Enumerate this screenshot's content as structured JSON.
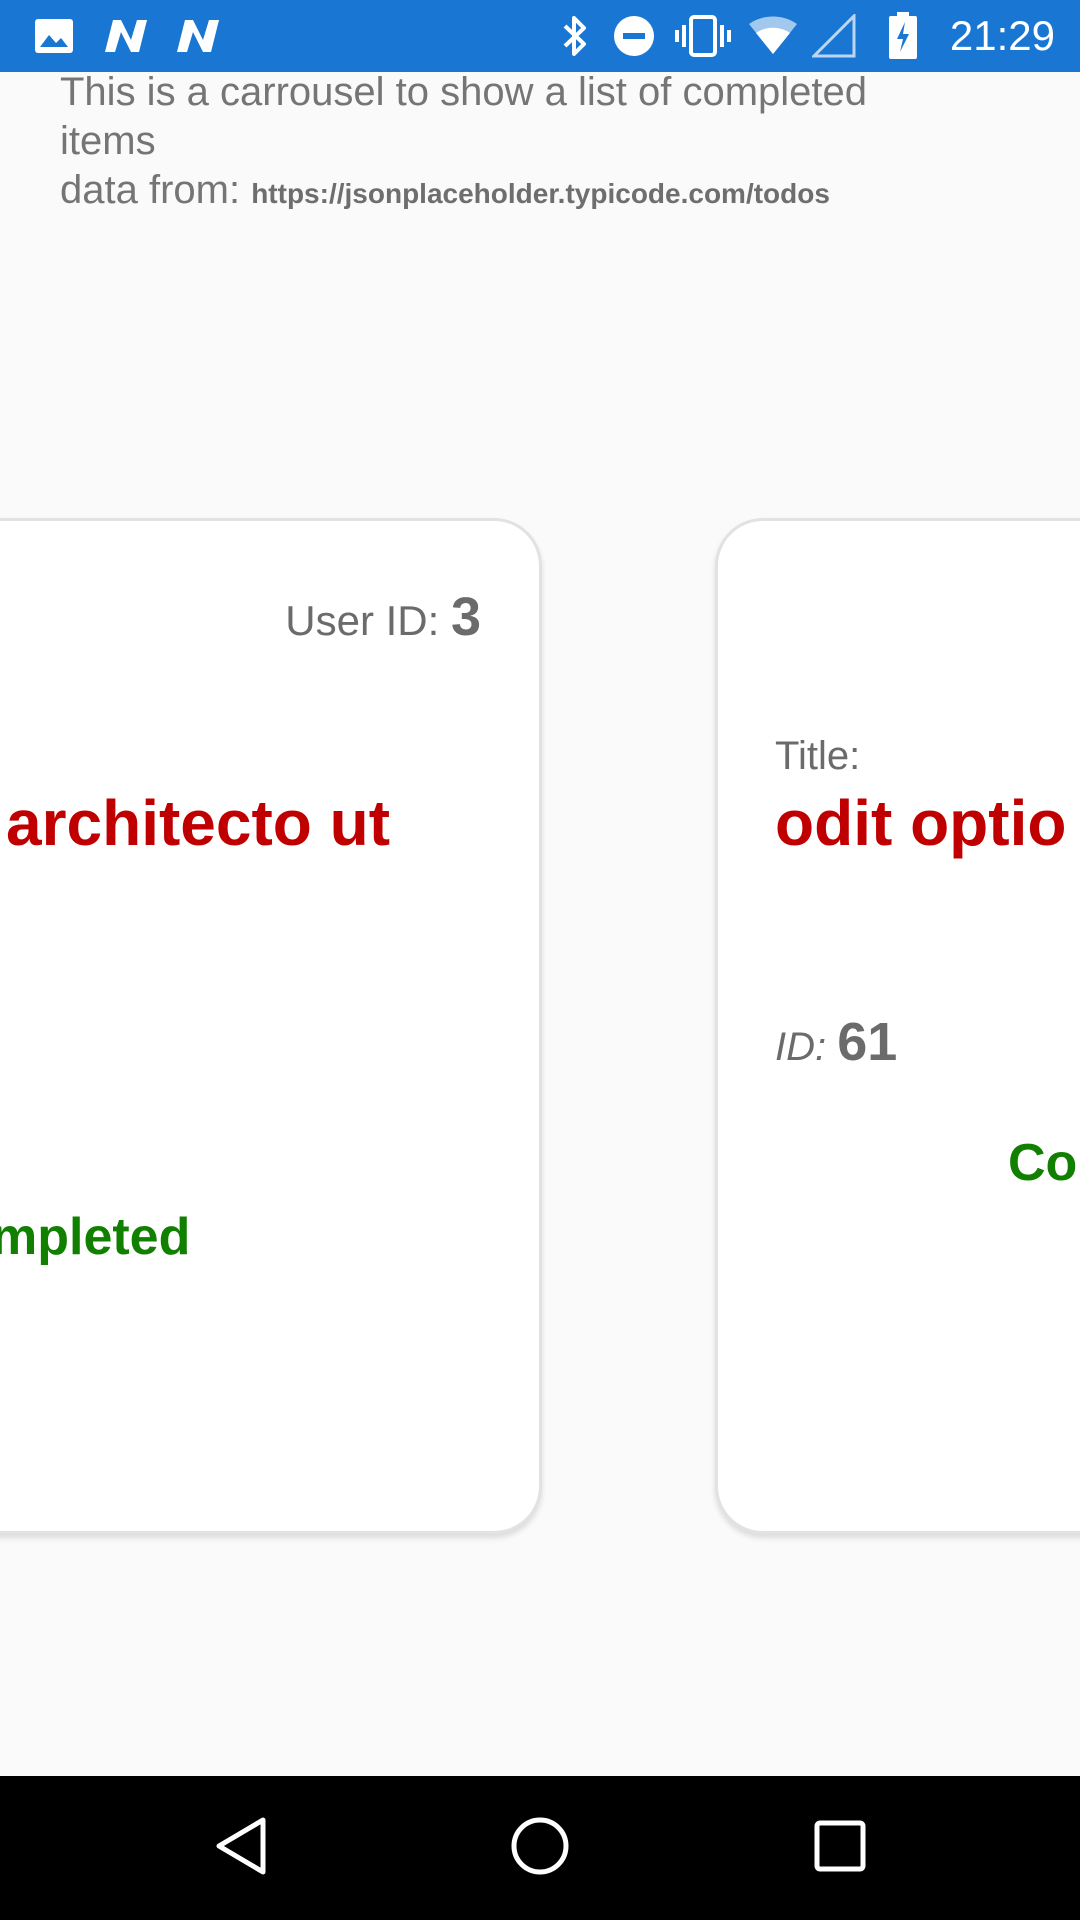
{
  "status_bar": {
    "time": "21:29",
    "left_icons": [
      "image-icon",
      "n-logo-icon",
      "n-logo-icon"
    ],
    "right_icons": [
      "bluetooth-icon",
      "do-not-disturb-icon",
      "vibrate-icon",
      "wifi-icon",
      "cell-signal-icon",
      "battery-charging-icon"
    ],
    "background": "#1976d2"
  },
  "intro": {
    "line1": "This is a carrousel to show a list of completed items",
    "data_from_label": "data from:",
    "url": "https://jsonplaceholder.typicode.com/todos"
  },
  "cards": [
    {
      "user_id_label": "User ID:",
      "user_id": "3",
      "title_text": "architecto ut",
      "status": "mpleted"
    },
    {
      "title_label": "Title:",
      "title_text": "odit optio c",
      "id_label": "ID:",
      "id": "61",
      "status": "Co"
    }
  ],
  "nav_bar": {
    "buttons": [
      "back-icon",
      "home-icon",
      "recents-icon"
    ]
  },
  "colors": {
    "title": "#c00000",
    "completed": "#118000",
    "label": "#6b6b6b"
  }
}
